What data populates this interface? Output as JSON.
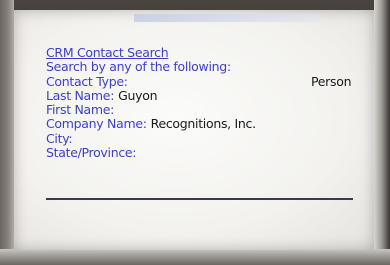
{
  "search": {
    "title": "CRM Contact Search",
    "instruction": "Search by any of the following:"
  },
  "fields": [
    {
      "label": "Contact Type:",
      "value": "Person"
    },
    {
      "label": "Last Name:",
      "value": "Guyon"
    },
    {
      "label": "First Name:",
      "value": ""
    },
    {
      "label": "Company Name:",
      "value": "Recognitions, Inc."
    },
    {
      "label": "City:",
      "value": ""
    },
    {
      "label": "State/Province:",
      "value": ""
    }
  ],
  "colors": {
    "label": "#3d3fc8",
    "value": "#1a1a1a",
    "screen": "#f3f2ef"
  }
}
